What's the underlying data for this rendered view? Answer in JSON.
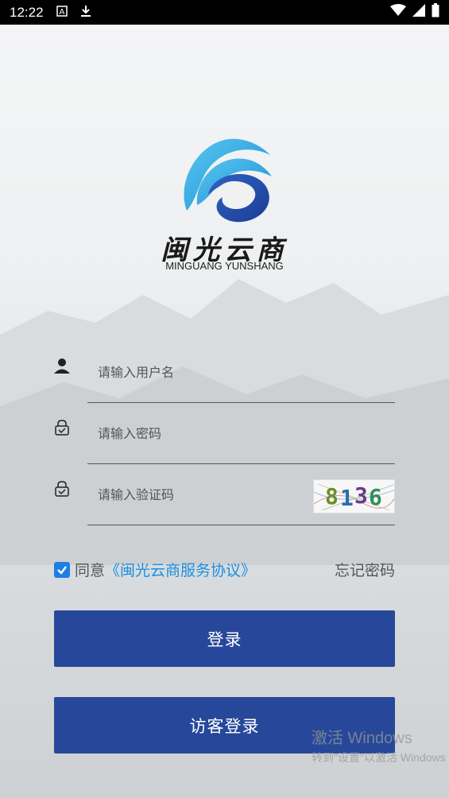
{
  "status_bar": {
    "time": "12:22"
  },
  "logo": {
    "name_cn": "闽光云商",
    "name_en": "MINGUANG YUNSHANG"
  },
  "form": {
    "username_placeholder": "请输入用户名",
    "password_placeholder": "请输入密码",
    "captcha_placeholder": "请输入验证码",
    "captcha_code": [
      "8",
      "1",
      "3",
      "6"
    ]
  },
  "agreement": {
    "checked": true,
    "prefix": "同意",
    "link": "《闽光云商服务协议》",
    "forgot": "忘记密码"
  },
  "buttons": {
    "login": "登录",
    "guest_login": "访客登录"
  },
  "watermark": {
    "line1": "激活 Windows",
    "line2": "转到\"设置\"以激活 Windows"
  },
  "colors": {
    "primary": "#27489a",
    "link": "#1e8ee0",
    "checkbox": "#1f7de6"
  }
}
